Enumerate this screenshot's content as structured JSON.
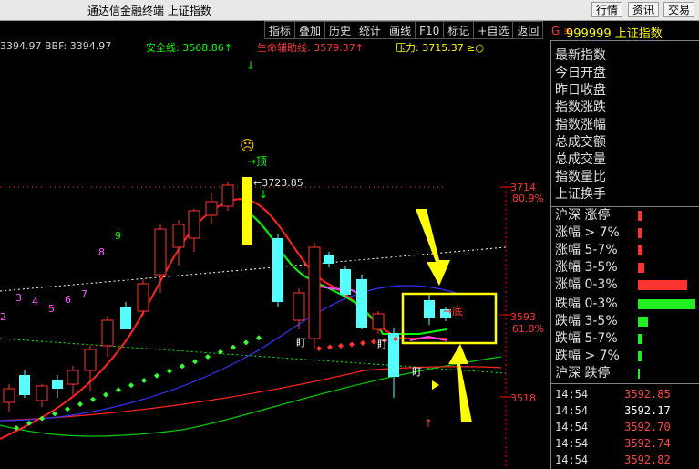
{
  "window": {
    "title": "通达信金融终端 上证指数",
    "buttons": [
      "行情",
      "资讯",
      "交易"
    ]
  },
  "toolbar": {
    "items": [
      "指标",
      "叠加",
      "历史",
      "统计",
      "画线",
      "F10",
      "标记",
      "+自选",
      "返回"
    ]
  },
  "indicators": {
    "line1": "3394.97 BBF: 3394.97",
    "safe": "安全线: 3568.86↑",
    "life": "生命辅助线: 3579.37↑",
    "pressure": "压力: 3715.37 ≥○"
  },
  "stock": {
    "g": "G ≡",
    "code": "999999 上证指数"
  },
  "price_axis": {
    "p3714": "3714",
    "pct809": "80.9%",
    "p3593": "3593",
    "pct618": "61.8%",
    "p3518": "3518"
  },
  "annotations": {
    "top": "→顶",
    "bottom": "→底",
    "peak": "←3723.85",
    "ding1": "盯",
    "ding2": "盯",
    "ding3": "盯",
    "emoji": "☹",
    "counts": [
      "2",
      "3",
      "4",
      "5",
      "6",
      "7",
      "8",
      "9"
    ]
  },
  "panel": {
    "labels": [
      "最新指数",
      "今日开盘",
      "昨日收盘",
      "指数涨跌",
      "指数涨幅",
      "总成交额",
      "总成交量",
      "指数量比",
      "上证换手"
    ],
    "dist_up": [
      {
        "label": "沪深 涨停",
        "v": 0.04
      },
      {
        "label": "涨幅 > 7%",
        "v": 0.04
      },
      {
        "label": "涨幅 5-7%",
        "v": 0.05
      },
      {
        "label": "涨幅 3-5%",
        "v": 0.08
      },
      {
        "label": "涨幅 0-3%",
        "v": 0.6
      }
    ],
    "dist_down": [
      {
        "label": "跌幅 0-3%",
        "v": 0.7
      },
      {
        "label": "跌幅 3-5%",
        "v": 0.12
      },
      {
        "label": "跌幅 5-7%",
        "v": 0.05
      },
      {
        "label": "跌幅 > 7%",
        "v": 0.04
      },
      {
        "label": "沪深 跌停",
        "v": 0.01
      }
    ],
    "ticks": [
      {
        "t": "14:54",
        "p": "3592.85",
        "c": "#ff4444"
      },
      {
        "t": "14:54",
        "p": "3592.17",
        "c": "#ffffff"
      },
      {
        "t": "14:54",
        "p": "3592.70",
        "c": "#ff4444"
      },
      {
        "t": "14:54",
        "p": "3592.74",
        "c": "#ff4444"
      },
      {
        "t": "14:54",
        "p": "3592.82",
        "c": "#ff4444"
      }
    ]
  },
  "colors": {
    "up": "#ff3232",
    "down": "#54ffff",
    "accent": "#ffff00"
  }
}
